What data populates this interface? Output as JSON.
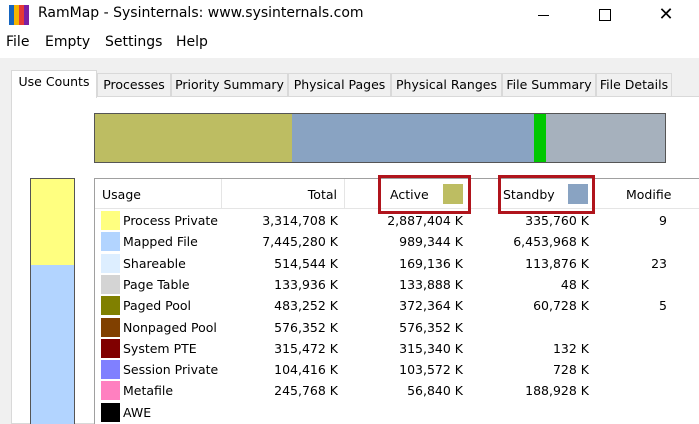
{
  "window": {
    "title": "RamMap - Sysinternals: www.sysinternals.com"
  },
  "menu": [
    "File",
    "Empty",
    "Settings",
    "Help"
  ],
  "tabs": [
    "Use Counts",
    "Processes",
    "Priority Summary",
    "Physical Pages",
    "Physical Ranges",
    "File Summary",
    "File Details"
  ],
  "active_tab": "Use Counts",
  "summary_bar": [
    {
      "name": "active",
      "fraction": 0.345,
      "color": "#bdbd62"
    },
    {
      "name": "standby",
      "fraction": 0.425,
      "color": "#89a3c2"
    },
    {
      "name": "modified",
      "fraction": 0.022,
      "color": "#00c800"
    },
    {
      "name": "other",
      "fraction": 0.208,
      "color": "#a6b1bd"
    }
  ],
  "left_bar": [
    {
      "name": "process-private",
      "fraction": 0.35,
      "color": "#ffff80"
    },
    {
      "name": "mapped-file",
      "fraction": 0.65,
      "color": "#b2d4ff"
    }
  ],
  "columns": {
    "usage": "Usage",
    "total": "Total",
    "active": "Active",
    "standby": "Standby",
    "modified": "Modifie"
  },
  "column_colors": {
    "active": "#bdbd62",
    "standby": "#89a3c2"
  },
  "rows": [
    {
      "usage": "Process Private",
      "color": "#ffff80",
      "total": "3,314,708 K",
      "active": "2,887,404 K",
      "standby": "335,760 K",
      "modified": "9"
    },
    {
      "usage": "Mapped File",
      "color": "#b2d4ff",
      "total": "7,445,280 K",
      "active": "989,344 K",
      "standby": "6,453,968 K",
      "modified": ""
    },
    {
      "usage": "Shareable",
      "color": "#ddeeff",
      "total": "514,544 K",
      "active": "169,136 K",
      "standby": "113,876 K",
      "modified": "23"
    },
    {
      "usage": "Page Table",
      "color": "#d4d4d4",
      "total": "133,936 K",
      "active": "133,888 K",
      "standby": "48 K",
      "modified": ""
    },
    {
      "usage": "Paged Pool",
      "color": "#808000",
      "total": "483,252 K",
      "active": "372,364 K",
      "standby": "60,728 K",
      "modified": "5"
    },
    {
      "usage": "Nonpaged Pool",
      "color": "#804000",
      "total": "576,352 K",
      "active": "576,352 K",
      "standby": "",
      "modified": ""
    },
    {
      "usage": "System PTE",
      "color": "#800000",
      "total": "315,472 K",
      "active": "315,340 K",
      "standby": "132 K",
      "modified": ""
    },
    {
      "usage": "Session Private",
      "color": "#8080ff",
      "total": "104,416 K",
      "active": "103,572 K",
      "standby": "728 K",
      "modified": ""
    },
    {
      "usage": "Metafile",
      "color": "#ff80c0",
      "total": "245,768 K",
      "active": "56,840 K",
      "standby": "188,928 K",
      "modified": ""
    },
    {
      "usage": "AWE",
      "color": "#000000",
      "total": "",
      "active": "",
      "standby": "",
      "modified": ""
    }
  ]
}
